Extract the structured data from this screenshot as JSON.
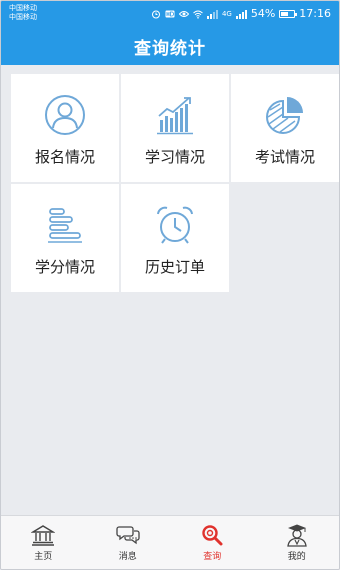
{
  "status_bar": {
    "carrier_1": "中国移动",
    "carrier_2": "中国移动",
    "network_label": "4G",
    "battery": "54%",
    "time": "17:16"
  },
  "header": {
    "title": "查询统计"
  },
  "tiles": [
    {
      "label": "报名情况",
      "icon": "user-circle-icon"
    },
    {
      "label": "学习情况",
      "icon": "bar-chart-icon"
    },
    {
      "label": "考试情况",
      "icon": "pie-chart-icon"
    },
    {
      "label": "学分情况",
      "icon": "list-bars-icon"
    },
    {
      "label": "历史订单",
      "icon": "alarm-clock-icon"
    }
  ],
  "tabbar": {
    "items": [
      {
        "label": "主页",
        "icon": "home-building-icon"
      },
      {
        "label": "消息",
        "icon": "chat-bubbles-icon"
      },
      {
        "label": "查询",
        "icon": "search-icon",
        "active": true
      },
      {
        "label": "我的",
        "icon": "profile-graduate-icon"
      }
    ]
  },
  "colors": {
    "brand": "#2699e6",
    "icon_blue": "#6fa8d8",
    "active": "#e0322d"
  }
}
